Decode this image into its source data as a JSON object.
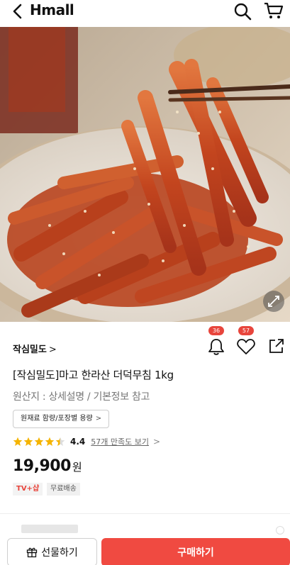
{
  "header": {
    "logo": "Hmall",
    "icons": [
      "back-icon",
      "search-icon",
      "cart-icon"
    ]
  },
  "product": {
    "brand": "작심밀도",
    "brand_chevron": ">",
    "like_count": "57",
    "alarm_count": "36",
    "title": "[작심밀도]마고 한라산 더덕무침 1kg",
    "origin": "원산지 : 상세설명 / 기본정보 참고",
    "info_button": "원재료 함량/포장별 용량",
    "info_chevron": ">",
    "rating": {
      "score": "4.4",
      "stars": 4.4,
      "review_link": "57개 만족도 보기",
      "chevron": ">"
    },
    "price": "19,900",
    "currency": "원",
    "tags": [
      "TV+샵",
      "무료배송"
    ]
  },
  "bottom": {
    "gift_label": "선물하기",
    "buy_label": "구매하기"
  },
  "colors": {
    "accent": "#f04a41",
    "badge": "#e8453c",
    "star": "#f5b400"
  }
}
